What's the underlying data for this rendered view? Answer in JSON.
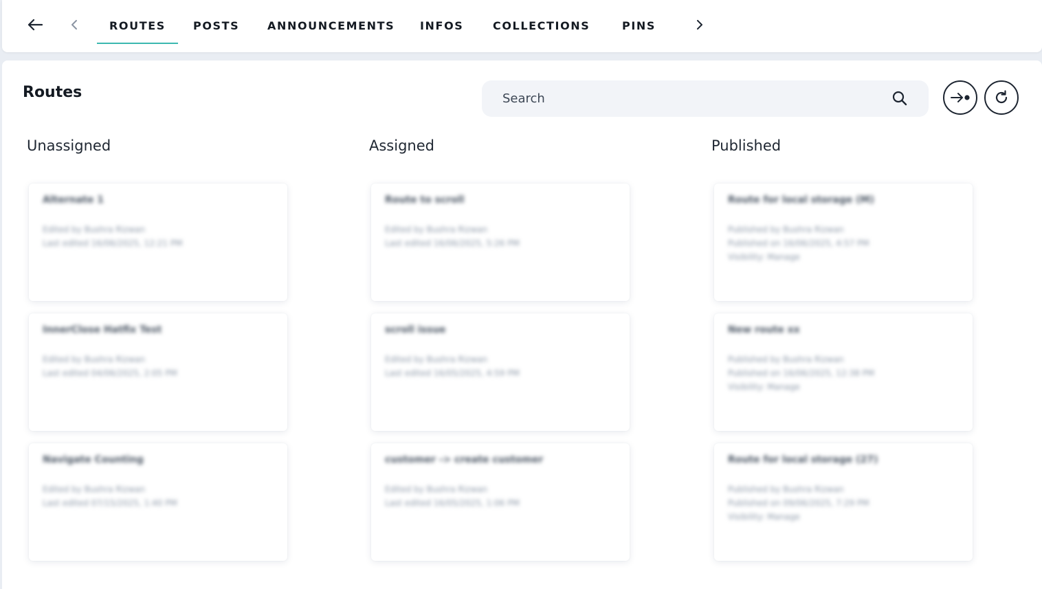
{
  "nav": {
    "tabs": [
      {
        "label": "ROUTES",
        "active": true
      },
      {
        "label": "POSTS"
      },
      {
        "label": "ANNOUNCEMENTS"
      },
      {
        "label": "INFOS"
      },
      {
        "label": "COLLECTIONS"
      },
      {
        "label": "PINS"
      }
    ],
    "accent_color": "#3bb8b0"
  },
  "icons": {
    "back": "arrow-left-icon",
    "prev": "chevron-left-icon",
    "next": "chevron-right-icon",
    "search": "search-icon",
    "assign": "arrow-to-dot-icon",
    "refresh": "refresh-icon"
  },
  "page": {
    "title": "Routes"
  },
  "search": {
    "placeholder": "Search"
  },
  "columns": [
    {
      "header": "Unassigned",
      "cards": [
        {
          "title": "Alternate 1",
          "line1": "Edited by Bushra Rizwan",
          "line2": "Last edited 16/06/2025, 12:21 PM"
        },
        {
          "title": "InnerClose Hatfix Test",
          "line1": "Edited by Bushra Rizwan",
          "line2": "Last edited 04/06/2025, 2:05 PM"
        },
        {
          "title": "Navigate Counting",
          "line1": "Edited by Bushra Rizwan",
          "line2": "Last edited 07/15/2025, 1:40 PM"
        }
      ]
    },
    {
      "header": "Assigned",
      "cards": [
        {
          "title": "Route to scroll",
          "line1": "Edited by Bushra Rizwan",
          "line2": "Last edited 16/06/2025, 5:26 PM"
        },
        {
          "title": "scroll issue",
          "line1": "Edited by Bushra Rizwan",
          "line2": "Last edited 16/05/2025, 4:59 PM"
        },
        {
          "title": "customer -> create customer",
          "line1": "Edited by Bushra Rizwan",
          "line2": "Last edited 16/05/2025, 1:06 PM"
        }
      ]
    },
    {
      "header": "Published",
      "cards": [
        {
          "title": "Route for local storage (M)",
          "line1": "Published by Bushra Rizwan",
          "line2": "Published on 16/06/2025, 4:57 PM",
          "line3": "Visibility: Manage"
        },
        {
          "title": "New route xx",
          "line1": "Published by Bushra Rizwan",
          "line2": "Published on 16/06/2025, 12:38 PM",
          "line3": "Visibility: Manage"
        },
        {
          "title": "Route for local storage (27)",
          "line1": "Published by Bushra Rizwan",
          "line2": "Published on 09/06/2025, 7:29 PM",
          "line3": "Visibility: Manage"
        }
      ]
    }
  ]
}
